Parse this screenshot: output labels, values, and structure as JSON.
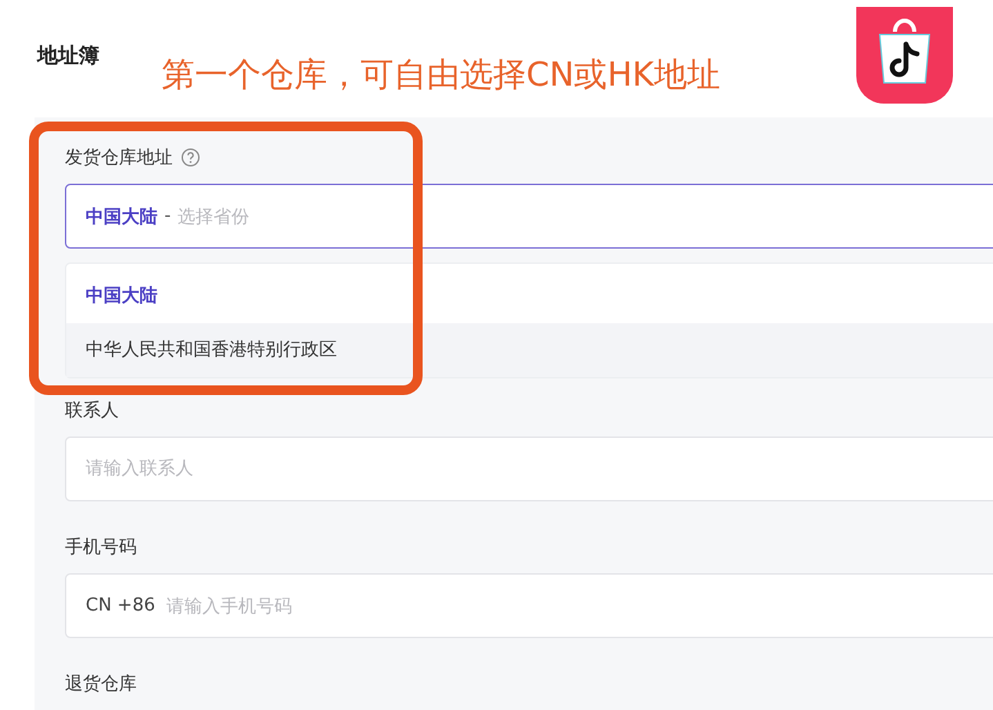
{
  "page": {
    "title": "地址簿"
  },
  "annotation": {
    "text": "第一个仓库，可自由选择CN或HK地址"
  },
  "warehouse": {
    "label": "发货仓库地址",
    "value": "中国大陆",
    "separator": "-",
    "placeholder": "选择省份",
    "focused": true,
    "options": [
      {
        "label": "中国大陆",
        "selected": true,
        "highlighted": false
      },
      {
        "label": "中华人民共和国香港特别行政区",
        "selected": false,
        "highlighted": true
      }
    ]
  },
  "contact": {
    "label": "联系人",
    "placeholder": "请输入联系人"
  },
  "phone": {
    "label": "手机号码",
    "prefix": "CN +86",
    "placeholder": "请输入手机号码"
  },
  "return_warehouse": {
    "label": "退货仓库"
  }
}
